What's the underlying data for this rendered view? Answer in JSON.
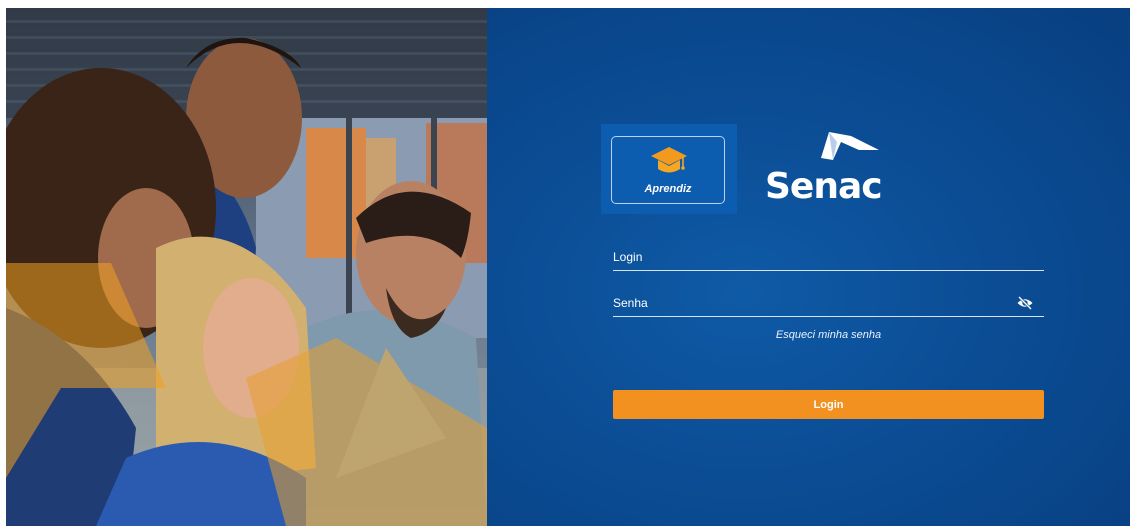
{
  "branding": {
    "app_name": "Aprendiz",
    "org_name": "Senac",
    "icons": {
      "app": "graduation-cap-icon",
      "org": "senac-logo"
    }
  },
  "form": {
    "login_label": "Login",
    "password_label": "Senha",
    "password_toggle_icon": "eye-off-icon",
    "forgot_link": "Esqueci minha senha",
    "submit_label": "Login"
  },
  "colors": {
    "panel_blue": "#0b4d95",
    "accent_orange": "#f29120",
    "text_white": "#ffffff"
  }
}
